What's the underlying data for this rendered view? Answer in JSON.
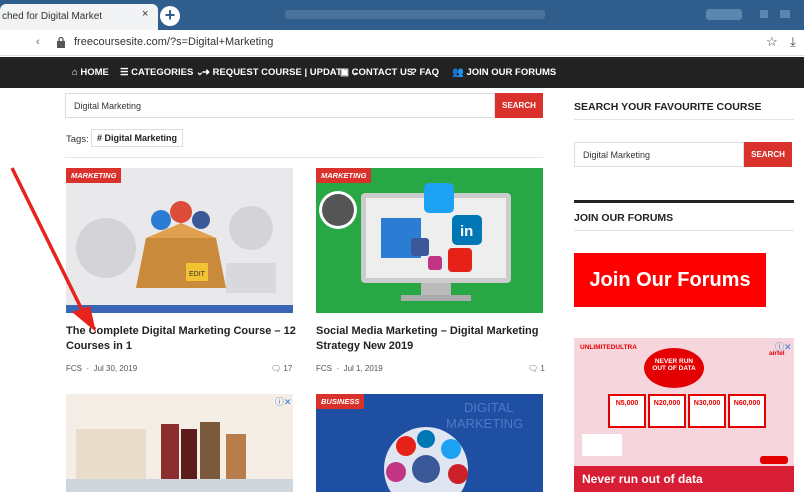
{
  "browser": {
    "tab_title": "ched for Digital Market",
    "tab_close": "×",
    "new_tab": "+",
    "url": "freecoursesite.com/?s=Digital+Marketing",
    "back_mark": "‹"
  },
  "nav": {
    "items": [
      {
        "label": "HOME",
        "icon": "home-icon"
      },
      {
        "label": "CATEGORIES",
        "icon": "menu-icon"
      },
      {
        "label": "REQUEST COURSE | UPDATE",
        "icon": "arrow-circle-icon"
      },
      {
        "label": "CONTACT US",
        "icon": "contact-icon"
      },
      {
        "label": "FAQ",
        "icon": "question-icon"
      },
      {
        "label": "JOIN OUR FORUMS",
        "icon": "users-icon"
      }
    ]
  },
  "search": {
    "value": "Digital Marketing",
    "button": "SEARCH"
  },
  "tags": {
    "label": "Tags:",
    "chip": "# Digital Marketing"
  },
  "posts": [
    {
      "category": "MARKETING",
      "title": "The Complete Digital Marketing Course – 12 Courses in 1",
      "author": "FCS",
      "date": "Jul 30, 2019",
      "comments": "17"
    },
    {
      "category": "MARKETING",
      "title": "Social Media Marketing – Digital Marketing Strategy New 2019",
      "author": "FCS",
      "date": "Jul 1, 2019",
      "comments": "1"
    },
    {
      "category": "",
      "title": "",
      "author": "",
      "date": "",
      "comments": ""
    },
    {
      "category": "BUSINESS",
      "title": "",
      "author": "",
      "date": "",
      "comments": ""
    }
  ],
  "thumb_text": {
    "digital": "DIGITAL",
    "marketing": "MARKETING",
    "in": "in",
    "edit": "EDIT"
  },
  "sidebar": {
    "search_title": "SEARCH YOUR FAVOURITE COURSE",
    "search_value": "Digital Marketing",
    "search_button": "SEARCH",
    "forums_title": "JOIN OUR FORUMS",
    "forums_banner": "Join Our Forums"
  },
  "ad": {
    "brand": "UNLIMITEDULTRA",
    "operator": "airtel",
    "headline1": "NEVER RUN",
    "headline2": "OUT OF DATA",
    "plans": [
      "N5,000",
      "N20,000",
      "N30,000",
      "N60,000"
    ],
    "footer": "Never run out of data",
    "adchoice": "ⓘ✕"
  },
  "colors": {
    "accent": "#d9312b",
    "nav_bg": "#222222",
    "chrome": "#2f5d8c",
    "arrow": "#e8231c"
  }
}
